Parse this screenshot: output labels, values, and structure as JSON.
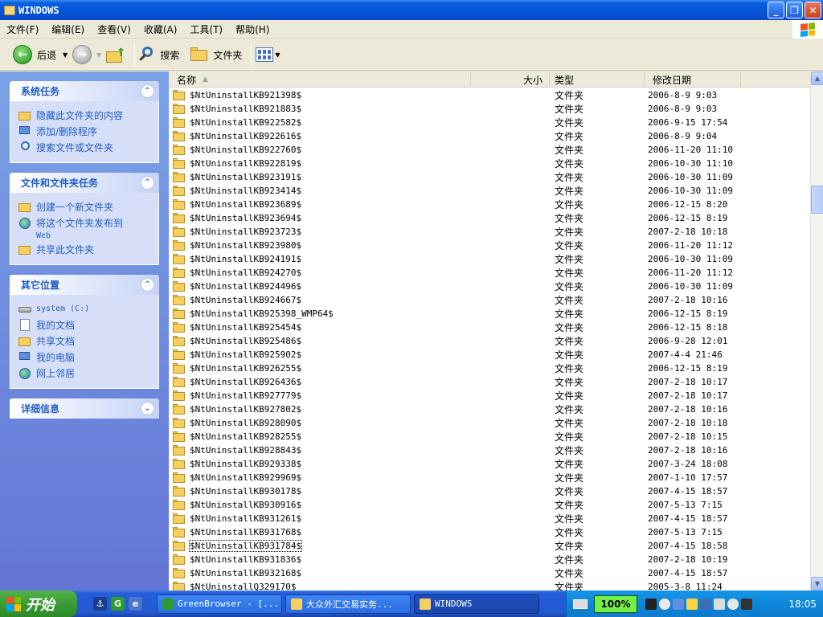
{
  "window": {
    "title": "WINDOWS",
    "buttons": {
      "minimize": "_",
      "maximize": "❐",
      "close": "✕"
    }
  },
  "menu": [
    "文件(F)",
    "编辑(E)",
    "查看(V)",
    "收藏(A)",
    "工具(T)",
    "帮助(H)"
  ],
  "toolbar": {
    "back_label": "后退",
    "search_label": "搜索",
    "folders_label": "文件夹"
  },
  "left_panel": {
    "system_tasks": {
      "title": "系统任务",
      "items": [
        {
          "label": "隐藏此文件夹的内容",
          "icon": "folder-icon"
        },
        {
          "label": "添加/删除程序",
          "icon": "programs-icon"
        },
        {
          "label": "搜索文件或文件夹",
          "icon": "search-icon"
        }
      ]
    },
    "file_tasks": {
      "title": "文件和文件夹任务",
      "items": [
        {
          "label": "创建一个新文件夹",
          "icon": "new-folder-icon"
        },
        {
          "label": "将这个文件夹发布到",
          "sub": "Web",
          "icon": "globe-icon"
        },
        {
          "label": "共享此文件夹",
          "icon": "share-folder-icon"
        }
      ]
    },
    "other_places": {
      "title": "其它位置",
      "items": [
        {
          "label": "system (C:)",
          "icon": "drive-icon"
        },
        {
          "label": "我的文档",
          "icon": "documents-icon"
        },
        {
          "label": "共享文档",
          "icon": "shared-documents-icon"
        },
        {
          "label": "我的电脑",
          "icon": "computer-icon"
        },
        {
          "label": "网上邻居",
          "icon": "network-icon"
        }
      ]
    },
    "details": {
      "title": "详细信息"
    }
  },
  "list": {
    "columns": {
      "name": "名称",
      "size": "大小",
      "type": "类型",
      "date": "修改日期"
    },
    "rows": [
      {
        "name": "$NtUninstallKB921398$",
        "type": "文件夹",
        "date": "2006-8-9 9:03"
      },
      {
        "name": "$NtUninstallKB921883$",
        "type": "文件夹",
        "date": "2006-8-9 9:03"
      },
      {
        "name": "$NtUninstallKB922582$",
        "type": "文件夹",
        "date": "2006-9-15 17:54"
      },
      {
        "name": "$NtUninstallKB922616$",
        "type": "文件夹",
        "date": "2006-8-9 9:04"
      },
      {
        "name": "$NtUninstallKB922760$",
        "type": "文件夹",
        "date": "2006-11-20 11:10"
      },
      {
        "name": "$NtUninstallKB922819$",
        "type": "文件夹",
        "date": "2006-10-30 11:10"
      },
      {
        "name": "$NtUninstallKB923191$",
        "type": "文件夹",
        "date": "2006-10-30 11:09"
      },
      {
        "name": "$NtUninstallKB923414$",
        "type": "文件夹",
        "date": "2006-10-30 11:09"
      },
      {
        "name": "$NtUninstallKB923689$",
        "type": "文件夹",
        "date": "2006-12-15 8:20"
      },
      {
        "name": "$NtUninstallKB923694$",
        "type": "文件夹",
        "date": "2006-12-15 8:19"
      },
      {
        "name": "$NtUninstallKB923723$",
        "type": "文件夹",
        "date": "2007-2-18 10:18"
      },
      {
        "name": "$NtUninstallKB923980$",
        "type": "文件夹",
        "date": "2006-11-20 11:12"
      },
      {
        "name": "$NtUninstallKB924191$",
        "type": "文件夹",
        "date": "2006-10-30 11:09"
      },
      {
        "name": "$NtUninstallKB924270$",
        "type": "文件夹",
        "date": "2006-11-20 11:12"
      },
      {
        "name": "$NtUninstallKB924496$",
        "type": "文件夹",
        "date": "2006-10-30 11:09"
      },
      {
        "name": "$NtUninstallKB924667$",
        "type": "文件夹",
        "date": "2007-2-18 10:16"
      },
      {
        "name": "$NtUninstallKB925398_WMP64$",
        "type": "文件夹",
        "date": "2006-12-15 8:19"
      },
      {
        "name": "$NtUninstallKB925454$",
        "type": "文件夹",
        "date": "2006-12-15 8:18"
      },
      {
        "name": "$NtUninstallKB925486$",
        "type": "文件夹",
        "date": "2006-9-28 12:01"
      },
      {
        "name": "$NtUninstallKB925902$",
        "type": "文件夹",
        "date": "2007-4-4 21:46"
      },
      {
        "name": "$NtUninstallKB926255$",
        "type": "文件夹",
        "date": "2006-12-15 8:19"
      },
      {
        "name": "$NtUninstallKB926436$",
        "type": "文件夹",
        "date": "2007-2-18 10:17"
      },
      {
        "name": "$NtUninstallKB927779$",
        "type": "文件夹",
        "date": "2007-2-18 10:17"
      },
      {
        "name": "$NtUninstallKB927802$",
        "type": "文件夹",
        "date": "2007-2-18 10:16"
      },
      {
        "name": "$NtUninstallKB928090$",
        "type": "文件夹",
        "date": "2007-2-18 10:18"
      },
      {
        "name": "$NtUninstallKB928255$",
        "type": "文件夹",
        "date": "2007-2-18 10:15"
      },
      {
        "name": "$NtUninstallKB928843$",
        "type": "文件夹",
        "date": "2007-2-18 10:16"
      },
      {
        "name": "$NtUninstallKB929338$",
        "type": "文件夹",
        "date": "2007-3-24 18:08"
      },
      {
        "name": "$NtUninstallKB929969$",
        "type": "文件夹",
        "date": "2007-1-10 17:57"
      },
      {
        "name": "$NtUninstallKB930178$",
        "type": "文件夹",
        "date": "2007-4-15 18:57"
      },
      {
        "name": "$NtUninstallKB930916$",
        "type": "文件夹",
        "date": "2007-5-13 7:15"
      },
      {
        "name": "$NtUninstallKB931261$",
        "type": "文件夹",
        "date": "2007-4-15 18:57"
      },
      {
        "name": "$NtUninstallKB931768$",
        "type": "文件夹",
        "date": "2007-5-13 7:15"
      },
      {
        "name": "$NtUninstallKB931784$",
        "type": "文件夹",
        "date": "2007-4-15 18:58",
        "focused": true
      },
      {
        "name": "$NtUninstallKB931836$",
        "type": "文件夹",
        "date": "2007-2-18 10:19"
      },
      {
        "name": "$NtUninstallKB932168$",
        "type": "文件夹",
        "date": "2007-4-15 18:57"
      },
      {
        "name": "$NtUninstallQ329170$",
        "type": "文件夹",
        "date": "2005-3-8 11:24"
      }
    ]
  },
  "taskbar": {
    "start_label": "开始",
    "tasks": [
      {
        "label": "GreenBrowser - [...",
        "icon": "greenbrowser-icon",
        "color": "#2e9b2e"
      },
      {
        "label": "大众外汇交易实务...",
        "icon": "folder-icon",
        "color": "#f5d061"
      },
      {
        "label": "WINDOWS",
        "icon": "folder-icon",
        "color": "#f5d061",
        "active": true
      }
    ],
    "zoom": "100%",
    "clock": "18:05"
  },
  "colors": {
    "title_blue": "#0554d8",
    "panel_blue": "#6375d6",
    "link_blue": "#215dc6",
    "start_green": "#3a9b34"
  }
}
